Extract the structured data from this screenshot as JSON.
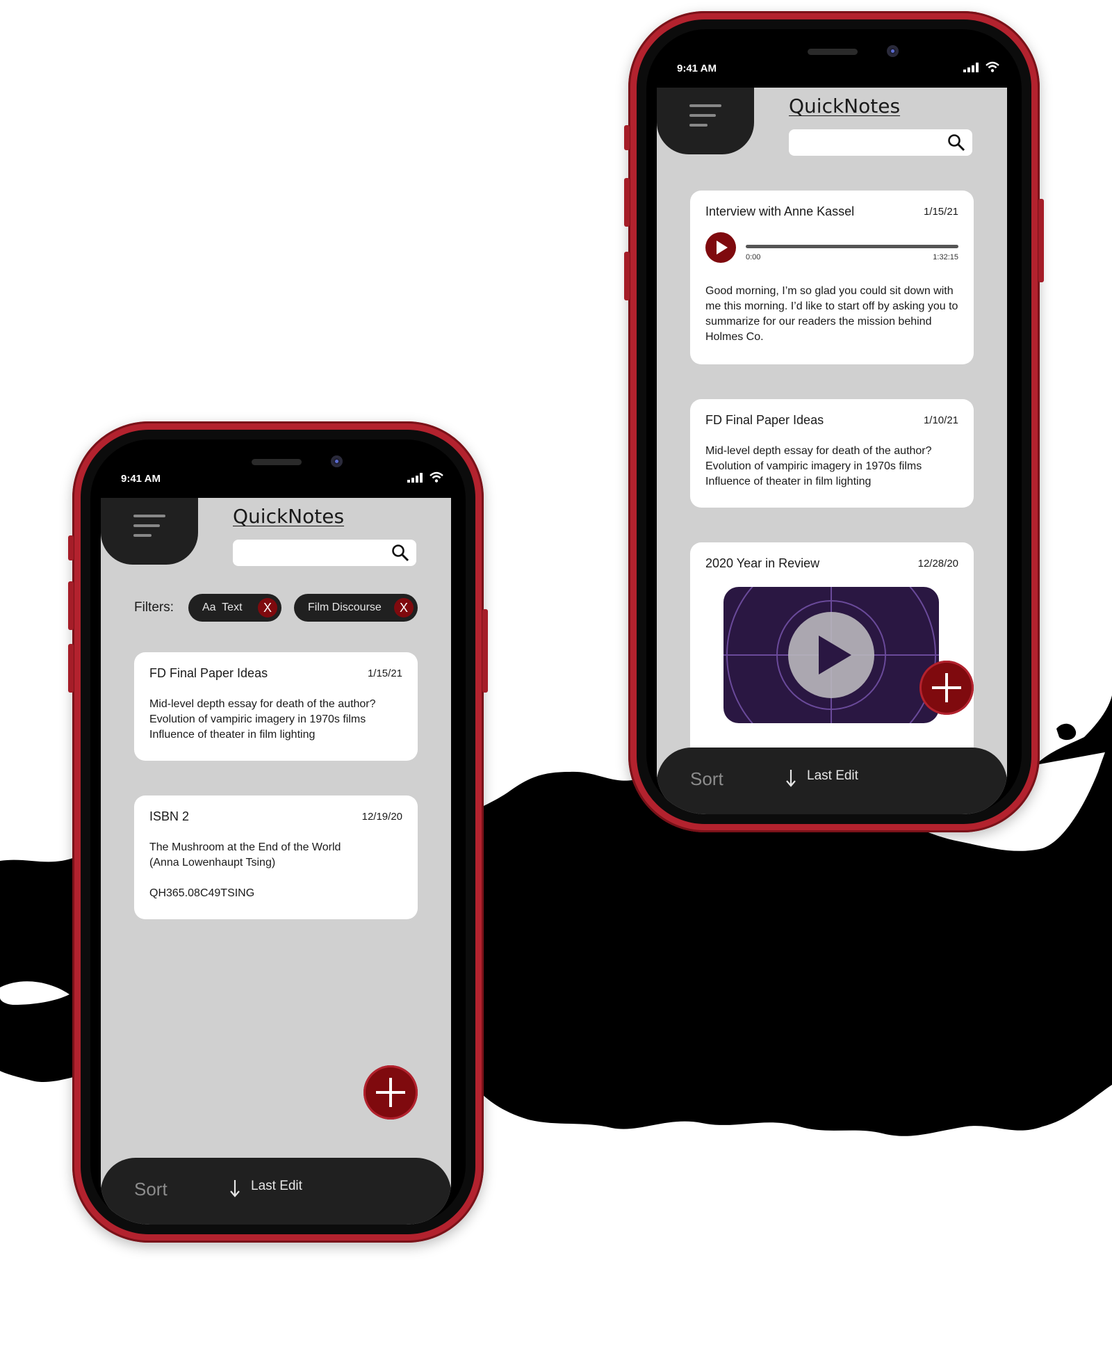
{
  "status_time": "9:41 AM",
  "app_title": "QuickNotes",
  "left_phone": {
    "filters_label": "Filters:",
    "filters": [
      {
        "label": "Aa  Text",
        "remove": "X"
      },
      {
        "label": "Film Discourse",
        "remove": "X"
      }
    ],
    "notes": [
      {
        "title": "FD Final Paper Ideas",
        "date": "1/15/21",
        "body": "Mid-level depth essay for death of the author?\nEvolution of vampiric imagery in 1970s films\nInfluence of theater in film lighting"
      },
      {
        "title": "ISBN 2",
        "date": "12/19/20",
        "body": "The Mushroom at the End of the World\n(Anna Lowenhaupt Tsing)",
        "extra": "QH365.08C49TSING"
      }
    ]
  },
  "right_phone": {
    "notes": [
      {
        "title": "Interview with Anne Kassel",
        "date": "1/15/21",
        "audio": {
          "start": "0:00",
          "end": "1:32:15",
          "progress": 0
        },
        "body": "Good morning, I’m so glad you could sit down with me this morning.  I’d like to start off by asking you to summarize for our readers the mission behind Holmes Co."
      },
      {
        "title": "FD Final Paper Ideas",
        "date": "1/10/21",
        "body": "Mid-level depth essay for death of the author?\nEvolution of vampiric imagery in 1970s films\nInfluence of theater in film lighting"
      },
      {
        "title": "2020 Year in Review",
        "date": "12/28/20",
        "media": "video-thumbnail"
      }
    ]
  },
  "sortbar": {
    "sort_label": "Sort",
    "last_edit": "Last Edit"
  },
  "colors": {
    "accent": "#7f0a0e",
    "frame": "#b3222e",
    "dark_bar": "#202020",
    "screen_bg": "#d0d0d0"
  }
}
